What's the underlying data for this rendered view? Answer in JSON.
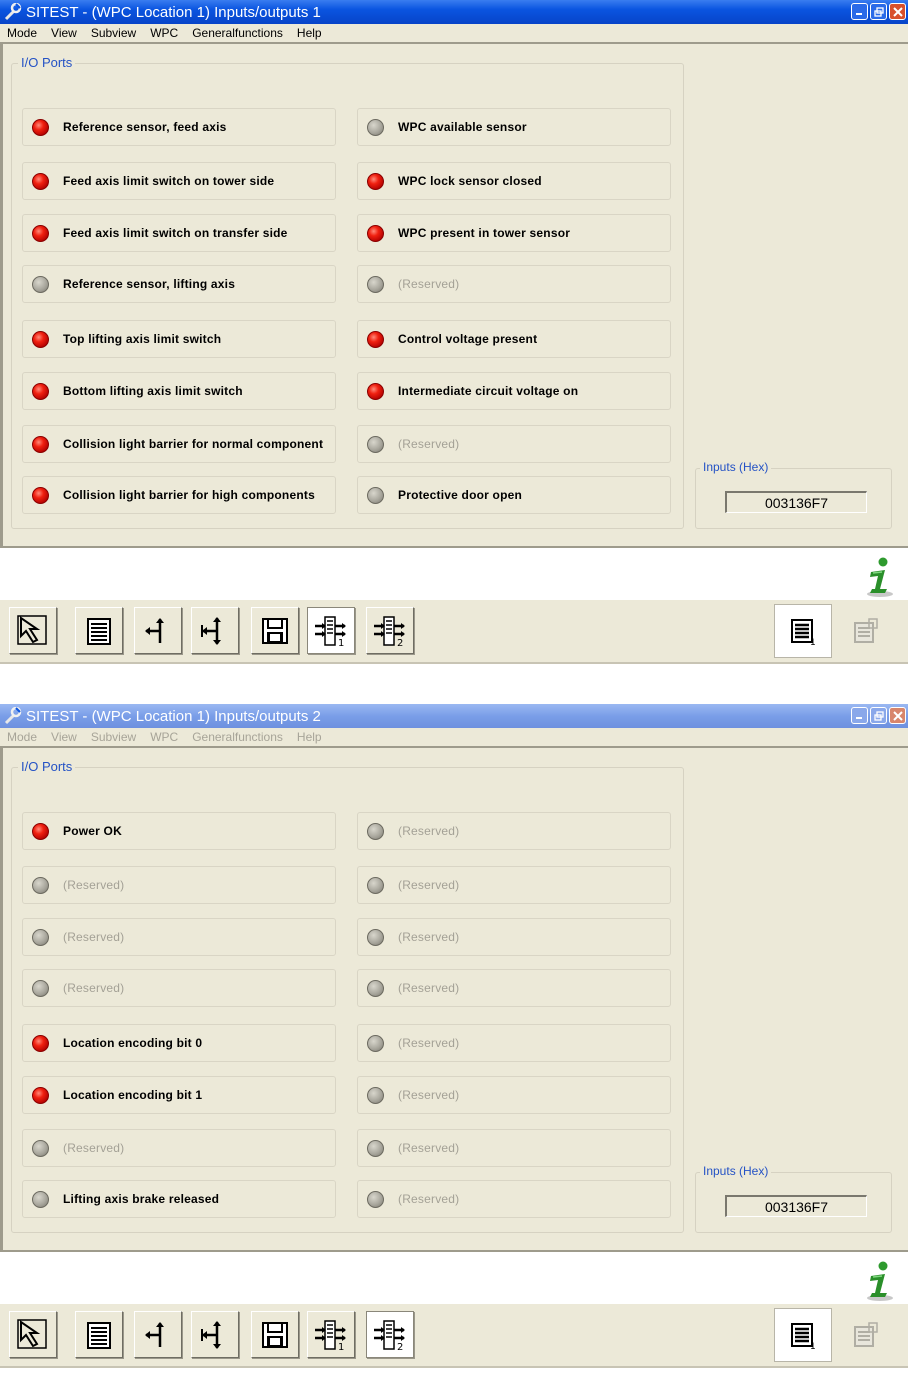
{
  "windows": [
    {
      "title": "SITEST - (WPC Location 1) Inputs/outputs 1",
      "menu": [
        "Mode",
        "View",
        "Subview",
        "WPC",
        "Generalfunctions",
        "Help"
      ],
      "group_label": "I/O Ports",
      "ports_left": [
        {
          "label": "Reference sensor, feed axis",
          "state": "on"
        },
        {
          "label": "Feed axis limit switch on tower side",
          "state": "on"
        },
        {
          "label": "Feed axis limit switch on transfer side",
          "state": "on"
        },
        {
          "label": "Reference sensor, lifting axis",
          "state": "off"
        },
        {
          "label": "Top lifting axis limit switch",
          "state": "on"
        },
        {
          "label": "Bottom lifting axis limit switch",
          "state": "on"
        },
        {
          "label": "Collision light barrier for normal component",
          "state": "on"
        },
        {
          "label": "Collision light barrier for high components",
          "state": "on"
        }
      ],
      "ports_right": [
        {
          "label": "WPC available sensor",
          "state": "off"
        },
        {
          "label": "WPC lock sensor closed",
          "state": "on"
        },
        {
          "label": "WPC present in tower sensor",
          "state": "on"
        },
        {
          "label": "(Reserved)",
          "state": "off"
        },
        {
          "label": "Control voltage present",
          "state": "on"
        },
        {
          "label": "Intermediate circuit voltage on",
          "state": "on"
        },
        {
          "label": "(Reserved)",
          "state": "off"
        },
        {
          "label": "Protective door open",
          "state": "off"
        }
      ],
      "hex_label": "Inputs (Hex)",
      "hex_value": "003136F7",
      "active_tool": 5
    },
    {
      "title": "SITEST - (WPC Location 1) Inputs/outputs 2",
      "menu": [
        "Mode",
        "View",
        "Subview",
        "WPC",
        "Generalfunctions",
        "Help"
      ],
      "group_label": "I/O Ports",
      "ports_left": [
        {
          "label": "Power OK",
          "state": "on"
        },
        {
          "label": "(Reserved)",
          "state": "off"
        },
        {
          "label": "(Reserved)",
          "state": "off"
        },
        {
          "label": "(Reserved)",
          "state": "off"
        },
        {
          "label": "Location encoding bit 0",
          "state": "on"
        },
        {
          "label": "Location encoding bit 1",
          "state": "on"
        },
        {
          "label": "(Reserved)",
          "state": "off"
        },
        {
          "label": "Lifting axis brake released",
          "state": "off"
        }
      ],
      "ports_right": [
        {
          "label": "(Reserved)",
          "state": "off"
        },
        {
          "label": "(Reserved)",
          "state": "off"
        },
        {
          "label": "(Reserved)",
          "state": "off"
        },
        {
          "label": "(Reserved)",
          "state": "off"
        },
        {
          "label": "(Reserved)",
          "state": "off"
        },
        {
          "label": "(Reserved)",
          "state": "off"
        },
        {
          "label": "(Reserved)",
          "state": "off"
        },
        {
          "label": "(Reserved)",
          "state": "off"
        }
      ],
      "hex_label": "Inputs (Hex)",
      "hex_value": "003136F7",
      "active_tool": 6
    }
  ],
  "toolbar_icons": [
    "pointer-icon",
    "list-icon",
    "move-axis-icon",
    "lifting-axis-icon",
    "save-icon",
    "io-page-1-icon",
    "io-page-2-icon"
  ],
  "colors": {
    "led_on": "#e8180c",
    "led_off": "#a9a79d",
    "group_label": "#2452c5",
    "panel": "#ece9d8"
  }
}
